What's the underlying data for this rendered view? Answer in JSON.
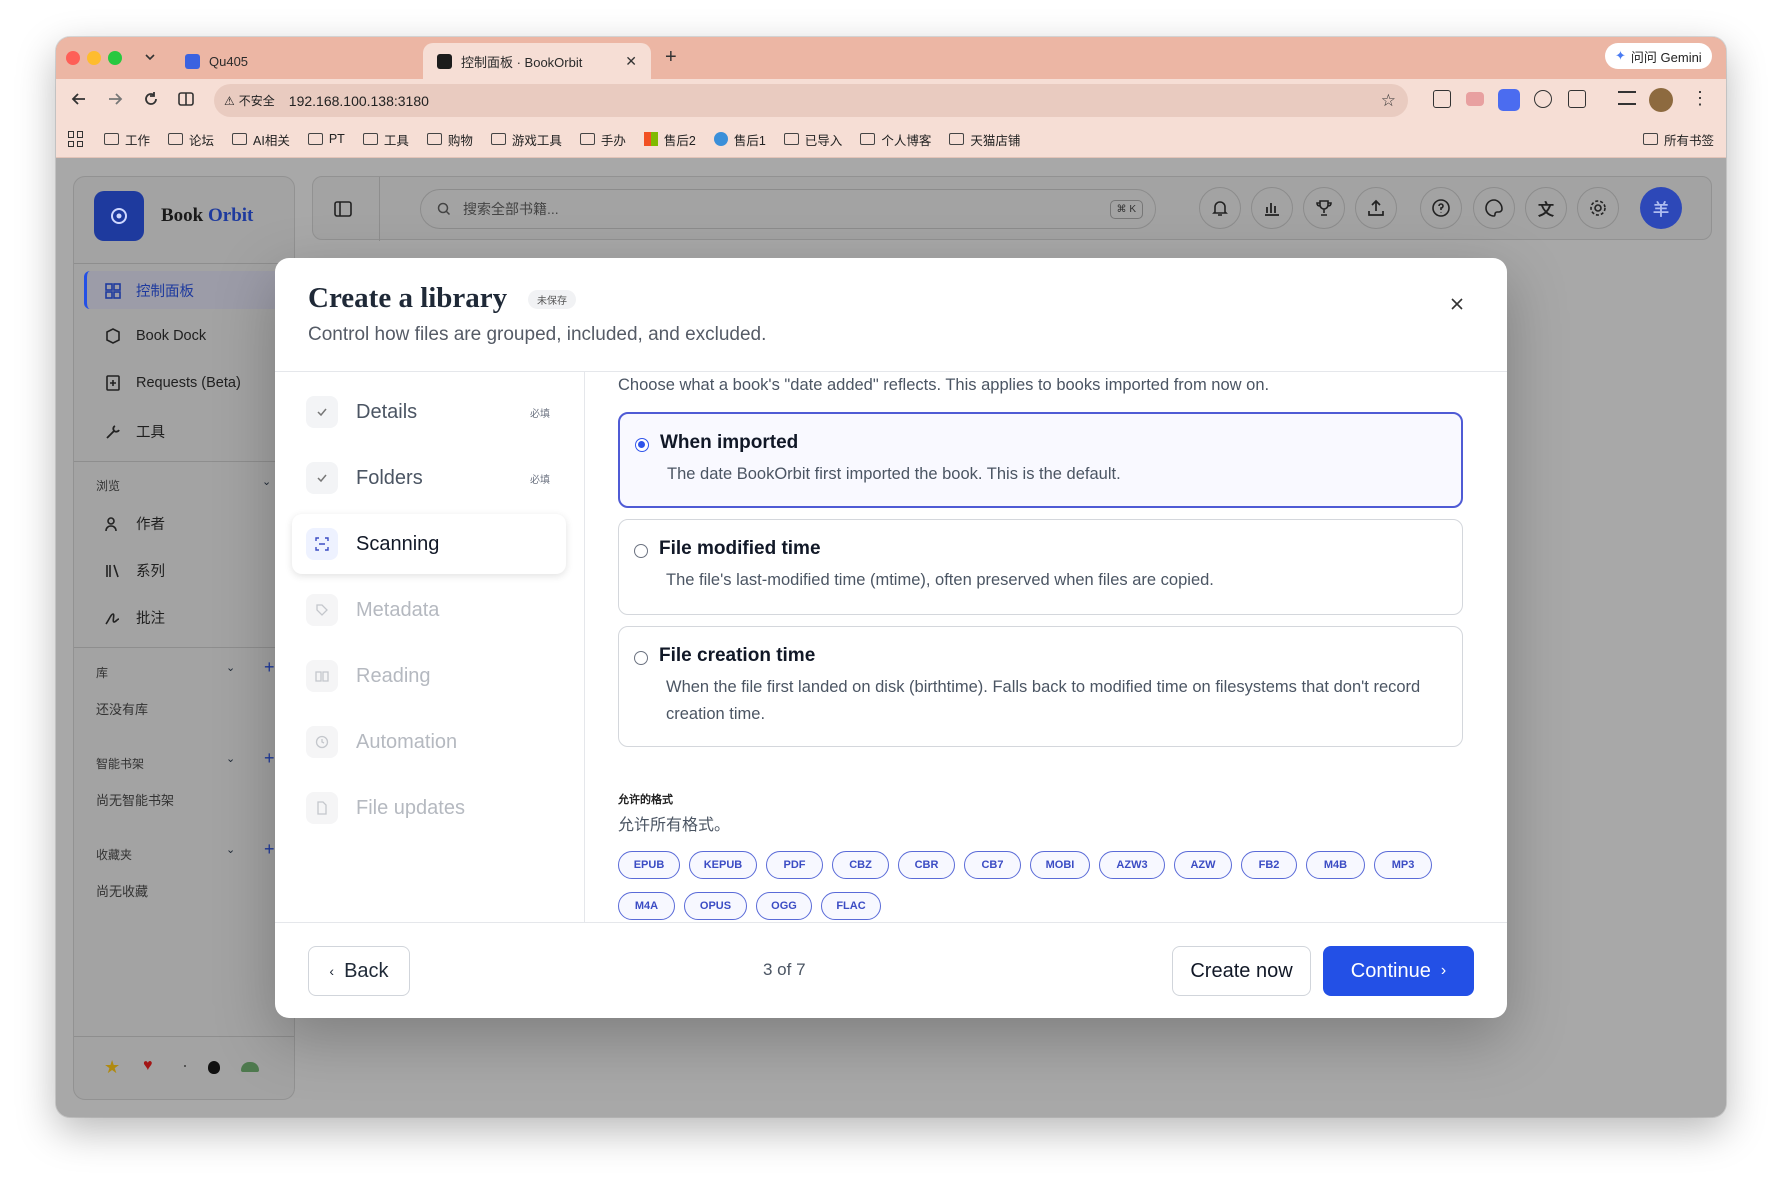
{
  "browser": {
    "tabs": [
      {
        "title": "Qu405"
      },
      {
        "title": "控制面板 · BookOrbit"
      }
    ],
    "gemini_label": "问问 Gemini",
    "security_label": "不安全",
    "url": "192.168.100.138:3180",
    "bookmarks": [
      "工作",
      "论坛",
      "AI相关",
      "PT",
      "工具",
      "购物",
      "游戏工具",
      "手办",
      "售后2",
      "售后1",
      "已导入",
      "个人博客",
      "天猫店铺"
    ],
    "all_bookmarks": "所有书签"
  },
  "app": {
    "brand_word1": "Book",
    "brand_word2": "Orbit",
    "brand_color": "#2350e6",
    "nav": [
      {
        "label": "控制面板",
        "icon": "dashboard-icon"
      },
      {
        "label": "Book Dock",
        "icon": "box-icon"
      },
      {
        "label": "Requests (Beta)",
        "icon": "request-icon"
      },
      {
        "label": "工具",
        "icon": "wrench-icon"
      }
    ],
    "browse_section": "浏览",
    "browse": [
      {
        "label": "作者",
        "icon": "users-icon"
      },
      {
        "label": "系列",
        "icon": "library-icon"
      },
      {
        "label": "批注",
        "icon": "signature-icon"
      }
    ],
    "library_section": "库",
    "library_empty": "还没有库",
    "smart_section": "智能书架",
    "smart_empty": "尚无智能书架",
    "fav_section": "收藏夹",
    "fav_empty": "尚无收藏",
    "search_placeholder": "搜索全部书籍...",
    "search_shortcut": "⌘ K",
    "avatar_text": "羊"
  },
  "modal": {
    "title": "Create a library",
    "badge": "未保存",
    "subtitle": "Control how files are grouped, included, and excluded.",
    "steps": [
      {
        "label": "Details",
        "state": "done",
        "required": "必填"
      },
      {
        "label": "Folders",
        "state": "done",
        "required": "必填"
      },
      {
        "label": "Scanning",
        "state": "active",
        "required": ""
      },
      {
        "label": "Metadata",
        "state": "pending",
        "required": ""
      },
      {
        "label": "Reading",
        "state": "pending",
        "required": ""
      },
      {
        "label": "Automation",
        "state": "pending",
        "required": ""
      },
      {
        "label": "File updates",
        "state": "pending",
        "required": ""
      }
    ],
    "intro": "Choose what a book's \"date added\" reflects. This applies to books imported from now on.",
    "options": [
      {
        "title": "When imported",
        "desc": "The date BookOrbit first imported the book. This is the default.",
        "selected": true
      },
      {
        "title": "File modified time",
        "desc": "The file's last-modified time (mtime), often preserved when files are copied.",
        "selected": false
      },
      {
        "title": "File creation time",
        "desc": "When the file first landed on disk (birthtime). Falls back to modified time on filesystems that don't record creation time.",
        "selected": false
      }
    ],
    "formats_label": "允许的格式",
    "formats_sub": "允许所有格式。",
    "formats": [
      "EPUB",
      "KEPUB",
      "PDF",
      "CBZ",
      "CBR",
      "CB7",
      "MOBI",
      "AZW3",
      "AZW",
      "FB2",
      "M4B",
      "MP3",
      "M4A",
      "OPUS",
      "OGG",
      "FLAC"
    ],
    "back": "Back",
    "progress": "3 of 7",
    "create_now": "Create now",
    "continue": "Continue"
  }
}
